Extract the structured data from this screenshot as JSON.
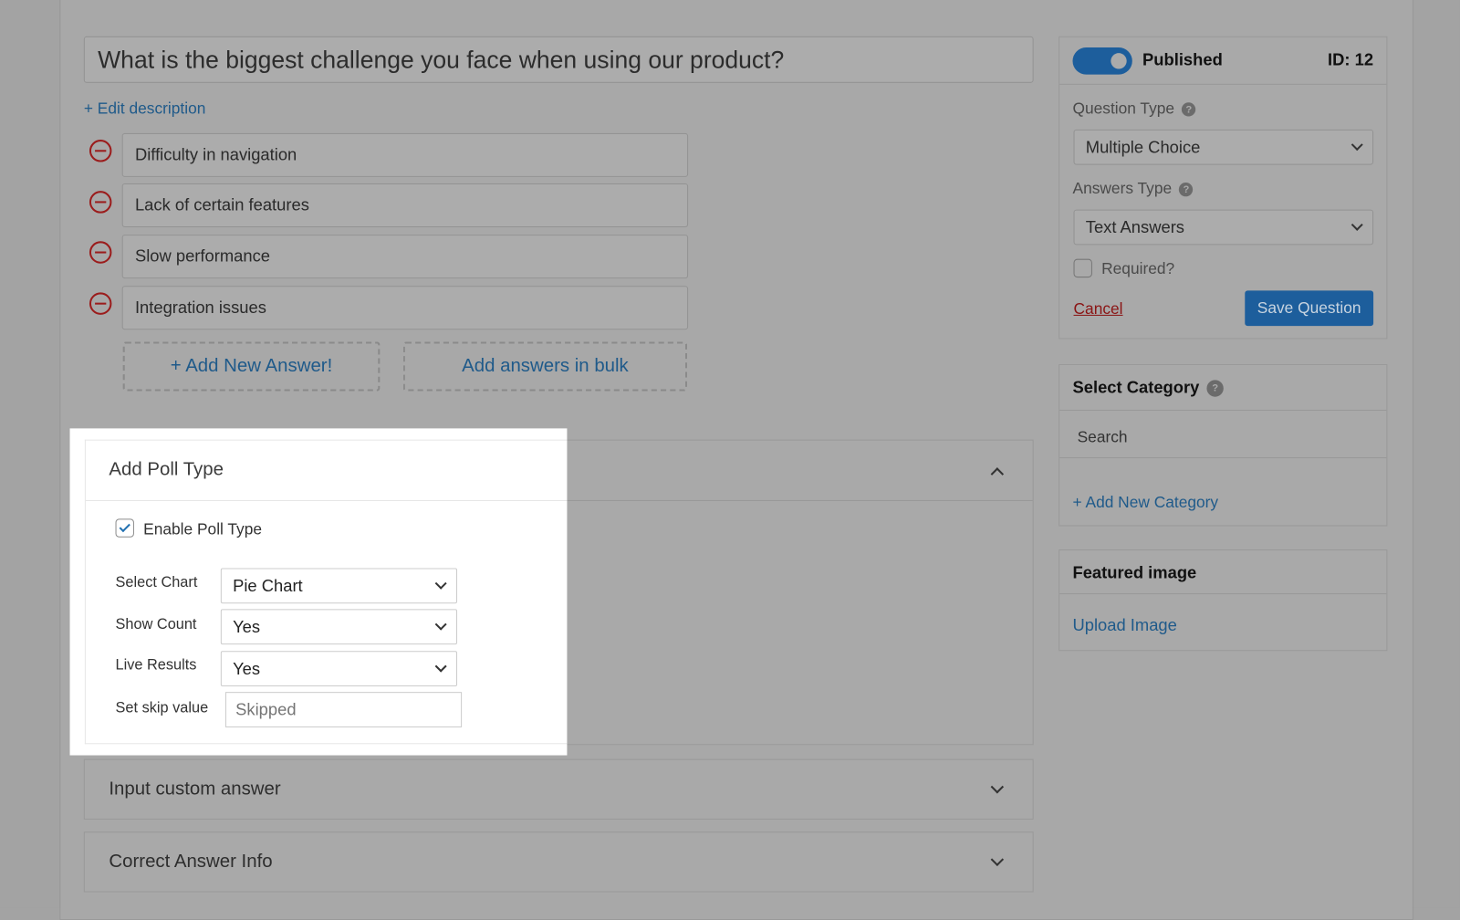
{
  "question": {
    "title": "What is the biggest challenge you face when using our product?",
    "edit_description": "+ Edit description"
  },
  "answers": [
    {
      "text": "Difficulty in navigation"
    },
    {
      "text": "Lack of certain features"
    },
    {
      "text": "Slow performance"
    },
    {
      "text": "Integration issues"
    }
  ],
  "buttons": {
    "add_new_answer": "+ Add New Answer!",
    "add_bulk": "Add answers in bulk"
  },
  "poll": {
    "title": "Add Poll Type",
    "enable_label": "Enable Poll Type",
    "enabled": true,
    "fields": [
      {
        "label": "Select Chart",
        "value": "Pie Chart"
      },
      {
        "label": "Show Count",
        "value": "Yes"
      },
      {
        "label": "Live Results",
        "value": "Yes"
      }
    ],
    "skip_label": "Set skip value",
    "skip_placeholder": "Skipped"
  },
  "sections": [
    {
      "title": "Input custom answer"
    },
    {
      "title": "Correct Answer Info"
    }
  ],
  "sidebar": {
    "published_label": "Published",
    "published": true,
    "id_label": "ID: 12",
    "question_type_label": "Question Type",
    "question_type": "Multiple Choice",
    "answers_type_label": "Answers Type",
    "answers_type": "Text Answers",
    "required_label": "Required?",
    "required": false,
    "cancel": "Cancel",
    "save": "Save Question",
    "category_title": "Select Category",
    "category_search": "Search",
    "add_category": "+ Add New Category",
    "featured_title": "Featured image",
    "upload": "Upload Image"
  },
  "colors": {
    "accent": "#1f5a8a",
    "danger": "#9b1c1c",
    "toggle": "#1d5e9c"
  }
}
